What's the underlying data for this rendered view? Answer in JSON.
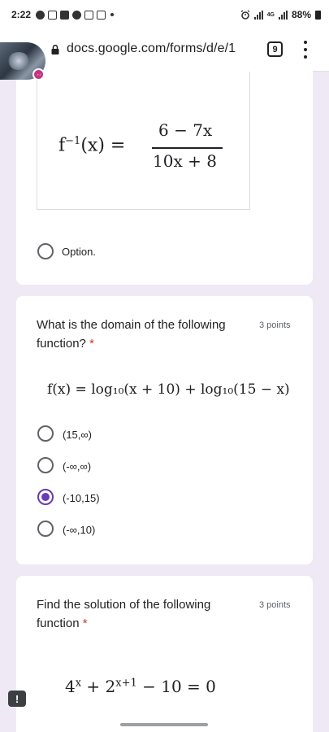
{
  "status_bar": {
    "time": "2:22",
    "battery_pct": "88%",
    "network": "4G",
    "left_icons": [
      "messenger-icon",
      "chat-bubble-icon",
      "youtube-icon",
      "facebook-icon",
      "gmail-icon",
      "gallery-icon"
    ],
    "right_icons": [
      "alarm-icon",
      "signal-icon",
      "signal-icon",
      "battery-icon"
    ]
  },
  "browser": {
    "url": "docs.google.com/forms/d/e/1",
    "tab_count": "9"
  },
  "questions": [
    {
      "formula_lhs": "f",
      "formula_sup": "−1",
      "formula_mid": "(x) =",
      "numerator": "6 − 7x",
      "denominator": "10x + 8",
      "options": [
        {
          "label": "Option.",
          "checked": false
        }
      ]
    },
    {
      "title": "What is the domain of the following function?",
      "required_mark": "*",
      "points": "3 points",
      "formula": "f(x) = log₁₀(x + 10) + log₁₀(15 − x)",
      "options": [
        {
          "label": "(15,∞)",
          "checked": false
        },
        {
          "label": "(-∞,∞)",
          "checked": false
        },
        {
          "label": "(-10,15)",
          "checked": true
        },
        {
          "label": "(-∞,10)",
          "checked": false
        }
      ]
    },
    {
      "title": "Find the solution of the following function",
      "required_mark": "*",
      "points": "3 points",
      "formula_a": "4",
      "formula_a_sup": "x",
      "formula_b": " + 2",
      "formula_b_sup": "x+1",
      "formula_c": " − 10 = 0"
    }
  ],
  "report_button": "!",
  "colors": {
    "accent": "#673ab7",
    "background": "#efe9f6",
    "required": "#d93025"
  }
}
